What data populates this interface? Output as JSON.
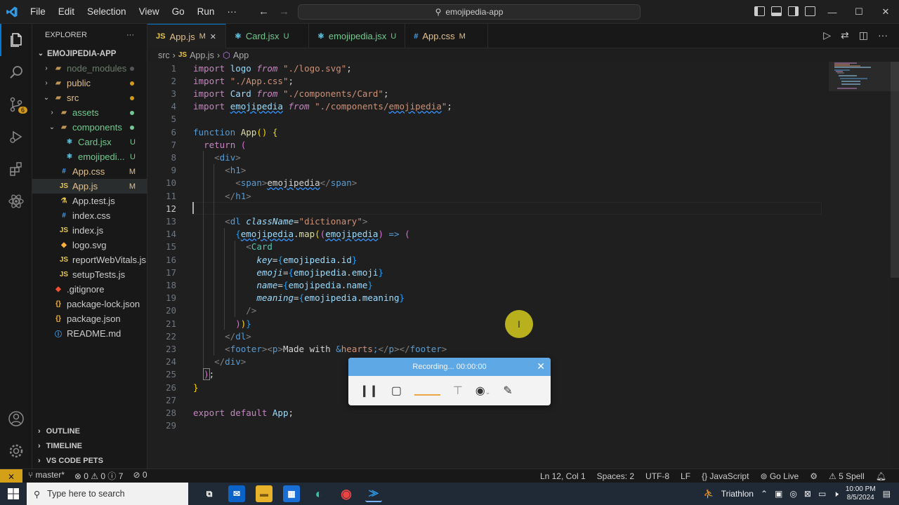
{
  "menu": [
    "File",
    "Edit",
    "Selection",
    "View",
    "Go",
    "Run",
    "···"
  ],
  "command_center": "emojipedia-app",
  "window_controls": [
    "—",
    "☐",
    "✕"
  ],
  "sidebar": {
    "header": "EXPLORER",
    "more": "···",
    "root": "EMOJIPEDIA-APP",
    "items": [
      {
        "label": "node_modules",
        "type": "folder",
        "indent": 1,
        "chev": "›",
        "color": "#6b7b6b",
        "dot": "#555"
      },
      {
        "label": "public",
        "type": "folder",
        "indent": 1,
        "chev": "›",
        "color": "#e2c08d",
        "dot": "#d19a1c"
      },
      {
        "label": "src",
        "type": "folder",
        "indent": 1,
        "chev": "⌄",
        "color": "#e2c08d",
        "dot": "#d19a1c"
      },
      {
        "label": "assets",
        "type": "folder",
        "indent": 2,
        "chev": "›",
        "color": "#73c991",
        "dot": "#73c991"
      },
      {
        "label": "components",
        "type": "folder",
        "indent": 2,
        "chev": "⌄",
        "color": "#73c991",
        "dot": "#73c991"
      },
      {
        "label": "Card.jsx",
        "type": "react",
        "indent": 3,
        "chev": "",
        "color": "#73c991",
        "status": "U"
      },
      {
        "label": "emojipedi...",
        "type": "react",
        "indent": 3,
        "chev": "",
        "color": "#73c991",
        "status": "U"
      },
      {
        "label": "App.css",
        "type": "css",
        "indent": 2,
        "chev": "",
        "color": "#e2c08d",
        "status": "M"
      },
      {
        "label": "App.js",
        "type": "js",
        "indent": 2,
        "chev": "",
        "color": "#e2c08d",
        "status": "M"
      },
      {
        "label": "App.test.js",
        "type": "test",
        "indent": 2,
        "chev": "",
        "color": "#ccc"
      },
      {
        "label": "index.css",
        "type": "css",
        "indent": 2,
        "chev": "",
        "color": "#ccc"
      },
      {
        "label": "index.js",
        "type": "js",
        "indent": 2,
        "chev": "",
        "color": "#ccc"
      },
      {
        "label": "logo.svg",
        "type": "svg",
        "indent": 2,
        "chev": "",
        "color": "#ccc"
      },
      {
        "label": "reportWebVitals.js",
        "type": "js",
        "indent": 2,
        "chev": "",
        "color": "#ccc"
      },
      {
        "label": "setupTests.js",
        "type": "js",
        "indent": 2,
        "chev": "",
        "color": "#ccc"
      },
      {
        "label": ".gitignore",
        "type": "git",
        "indent": 1,
        "chev": "",
        "color": "#ccc"
      },
      {
        "label": "package-lock.json",
        "type": "json",
        "indent": 1,
        "chev": "",
        "color": "#ccc"
      },
      {
        "label": "package.json",
        "type": "json",
        "indent": 1,
        "chev": "",
        "color": "#ccc"
      },
      {
        "label": "README.md",
        "type": "md",
        "indent": 1,
        "chev": "",
        "color": "#ccc"
      }
    ],
    "sections": [
      "OUTLINE",
      "TIMELINE",
      "VS CODE PETS"
    ]
  },
  "source_control_badge": "6",
  "tabs": [
    {
      "label": "App.js",
      "icon": "JS",
      "status": "M",
      "close": "✕",
      "active": true,
      "color": "#e2c08d"
    },
    {
      "label": "Card.jsx",
      "icon": "⚛",
      "status": "U",
      "active": false,
      "color": "#73c991"
    },
    {
      "label": "emojipedia.jsx",
      "icon": "⚛",
      "status": "U",
      "active": false,
      "color": "#73c991"
    },
    {
      "label": "App.css",
      "icon": "#",
      "status": "M",
      "active": false,
      "color": "#e2c08d"
    }
  ],
  "breadcrumb": {
    "folder": "src",
    "sep": "›",
    "file": "App.js",
    "symbol": "App"
  },
  "editor": {
    "current_line": 12,
    "lines": [
      "<span class='kw'>import</span> <span class='var'>logo</span> <span class='kw' style='font-style:italic'>from</span> <span class='str'>\"./logo.svg\"</span><span class='plain'>;</span>",
      "<span class='kw'>import</span> <span class='str'>\"./App.css\"</span><span class='plain'>;</span>",
      "<span class='kw'>import</span> <span class='var'>Card</span> <span class='kw' style='font-style:italic'>from</span> <span class='str'>\"./components/Card\"</span><span class='plain'>;</span>",
      "<span class='kw'>import</span> <span class='var squig'>emojipedia</span> <span class='kw' style='font-style:italic'>from</span> <span class='str'>\"./components/<span class='squig'>emojipedia</span>\"</span><span class='plain'>;</span>",
      "",
      "<span class='kb'>function</span> <span class='fn'>App</span><span class='br1'>()</span> <span class='br1'>{</span>",
      "  <span class='kw'>return</span> <span class='br2'>(</span>",
      "    <span class='gr'>&lt;</span><span class='kb'>div</span><span class='gr'>&gt;</span>",
      "      <span class='gr'>&lt;</span><span class='kb'>h1</span><span class='gr'>&gt;</span>",
      "        <span class='gr'>&lt;</span><span class='kb'>span</span><span class='gr'>&gt;</span><span class='plain squig'>emojipedia</span><span class='gr'>&lt;/</span><span class='kb'>span</span><span class='gr'>&gt;</span>",
      "      <span class='gr'>&lt;/</span><span class='kb'>h1</span><span class='gr'>&gt;</span>",
      "",
      "      <span class='gr'>&lt;</span><span class='kb'>dl</span> <span class='at'>className</span><span class='plain'>=</span><span class='str'>\"dictionary\"</span><span class='gr'>&gt;</span>",
      "        <span class='br3'>{</span><span class='var squig'>emojipedia</span><span class='plain'>.</span><span class='fn'>map</span><span class='br1'>(</span><span class='br2'>(</span><span class='var squig'>emojipedia</span><span class='br2'>)</span> <span class='kb'>=&gt;</span> <span class='br2'>(</span>",
      "          <span class='gr'>&lt;</span><span class='tag'>Card</span>",
      "            <span class='at'>key</span><span class='plain'>=</span><span class='br3'>{</span><span class='var'>emojipedia</span><span class='plain'>.</span><span class='var'>id</span><span class='br3'>}</span>",
      "            <span class='at'>emoji</span><span class='plain'>=</span><span class='br3'>{</span><span class='var'>emojipedia</span><span class='plain'>.</span><span class='var'>emoji</span><span class='br3'>}</span>",
      "            <span class='at'>name</span><span class='plain'>=</span><span class='br3'>{</span><span class='var'>emojipedia</span><span class='plain'>.</span><span class='var'>name</span><span class='br3'>}</span>",
      "            <span class='at'>meaning</span><span class='plain'>=</span><span class='br3'>{</span><span class='var'>emojipedia</span><span class='plain'>.</span><span class='var'>meaning</span><span class='br3'>}</span>",
      "          <span class='gr'>/&gt;</span>",
      "        <span class='br2'>)</span><span class='br1'>)</span><span class='br3'>}</span>",
      "      <span class='gr'>&lt;/</span><span class='kb'>dl</span><span class='gr'>&gt;</span>",
      "      <span class='gr'>&lt;</span><span class='kb'>footer</span><span class='gr'>&gt;&lt;</span><span class='kb'>p</span><span class='gr'>&gt;</span><span class='plain'>Made with </span><span class='ent'>&amp;</span><span class='str'>hearts</span><span class='ent'>;</span><span class='gr'>&lt;/</span><span class='kb'>p</span><span class='gr'>&gt;&lt;/</span><span class='kb'>footer</span><span class='gr'>&gt;</span>",
      "    <span class='gr'>&lt;/</span><span class='kb'>div</span><span class='gr'>&gt;</span>",
      "  <span class='br2' style='outline:1px solid #888'>)</span><span class='plain'>;</span>",
      "<span class='br1'>}</span>",
      "",
      "<span class='kw'>export</span> <span class='kw'>default</span> <span class='var'>App</span><span class='plain'>;</span>",
      ""
    ]
  },
  "recorder": {
    "title": "Recording... 00:00:00",
    "close": "✕"
  },
  "status_bar": {
    "branch": "master*",
    "errors": "0",
    "warnings": "0",
    "info": "7",
    "ports": "0",
    "position": "Ln 12, Col 1",
    "spaces": "Spaces: 2",
    "encoding": "UTF-8",
    "eol": "LF",
    "language": "JavaScript",
    "golive": "Go Live",
    "spell": "5 Spell"
  },
  "taskbar": {
    "search_placeholder": "Type here to search",
    "weather": "Triathlon",
    "time": "10:00 PM",
    "date": "8/5/2024"
  }
}
